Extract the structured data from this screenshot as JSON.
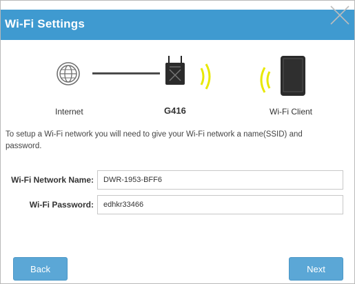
{
  "dialog": {
    "title": "Wi-Fi Settings"
  },
  "diagram": {
    "internet_label": "Internet",
    "router_label": "G416",
    "client_label": "Wi-Fi Client",
    "wave_color": "#e8e800"
  },
  "description": "To setup a Wi-Fi network you will need to give your Wi-Fi network a name(SSID) and password.",
  "form": {
    "network_name_label": "Wi-Fi Network Name:",
    "network_name_value": "DWR-1953-BFF6",
    "password_label": "Wi-Fi Password:",
    "password_value": "edhkr33466"
  },
  "buttons": {
    "back_label": "Back",
    "next_label": "Next"
  },
  "colors": {
    "header": "#3f9ad0",
    "button": "#5ba7d6"
  }
}
